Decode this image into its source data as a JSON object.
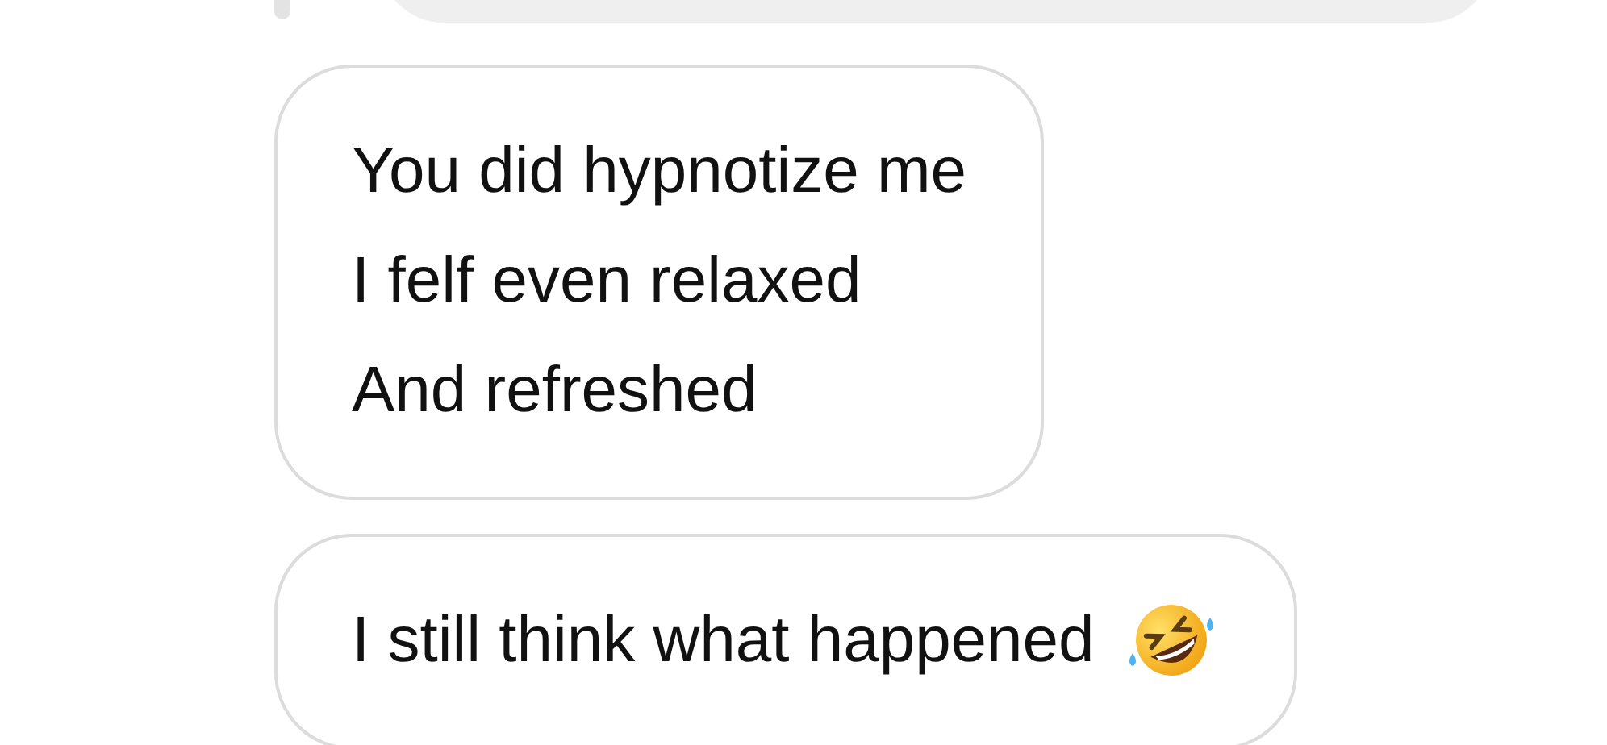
{
  "messages": [
    {
      "lines": [
        "You did hypnotize me",
        "I felf even relaxed",
        "And refreshed"
      ],
      "has_emoji": false
    },
    {
      "lines": [
        "I still think what happened"
      ],
      "has_emoji": true
    }
  ]
}
